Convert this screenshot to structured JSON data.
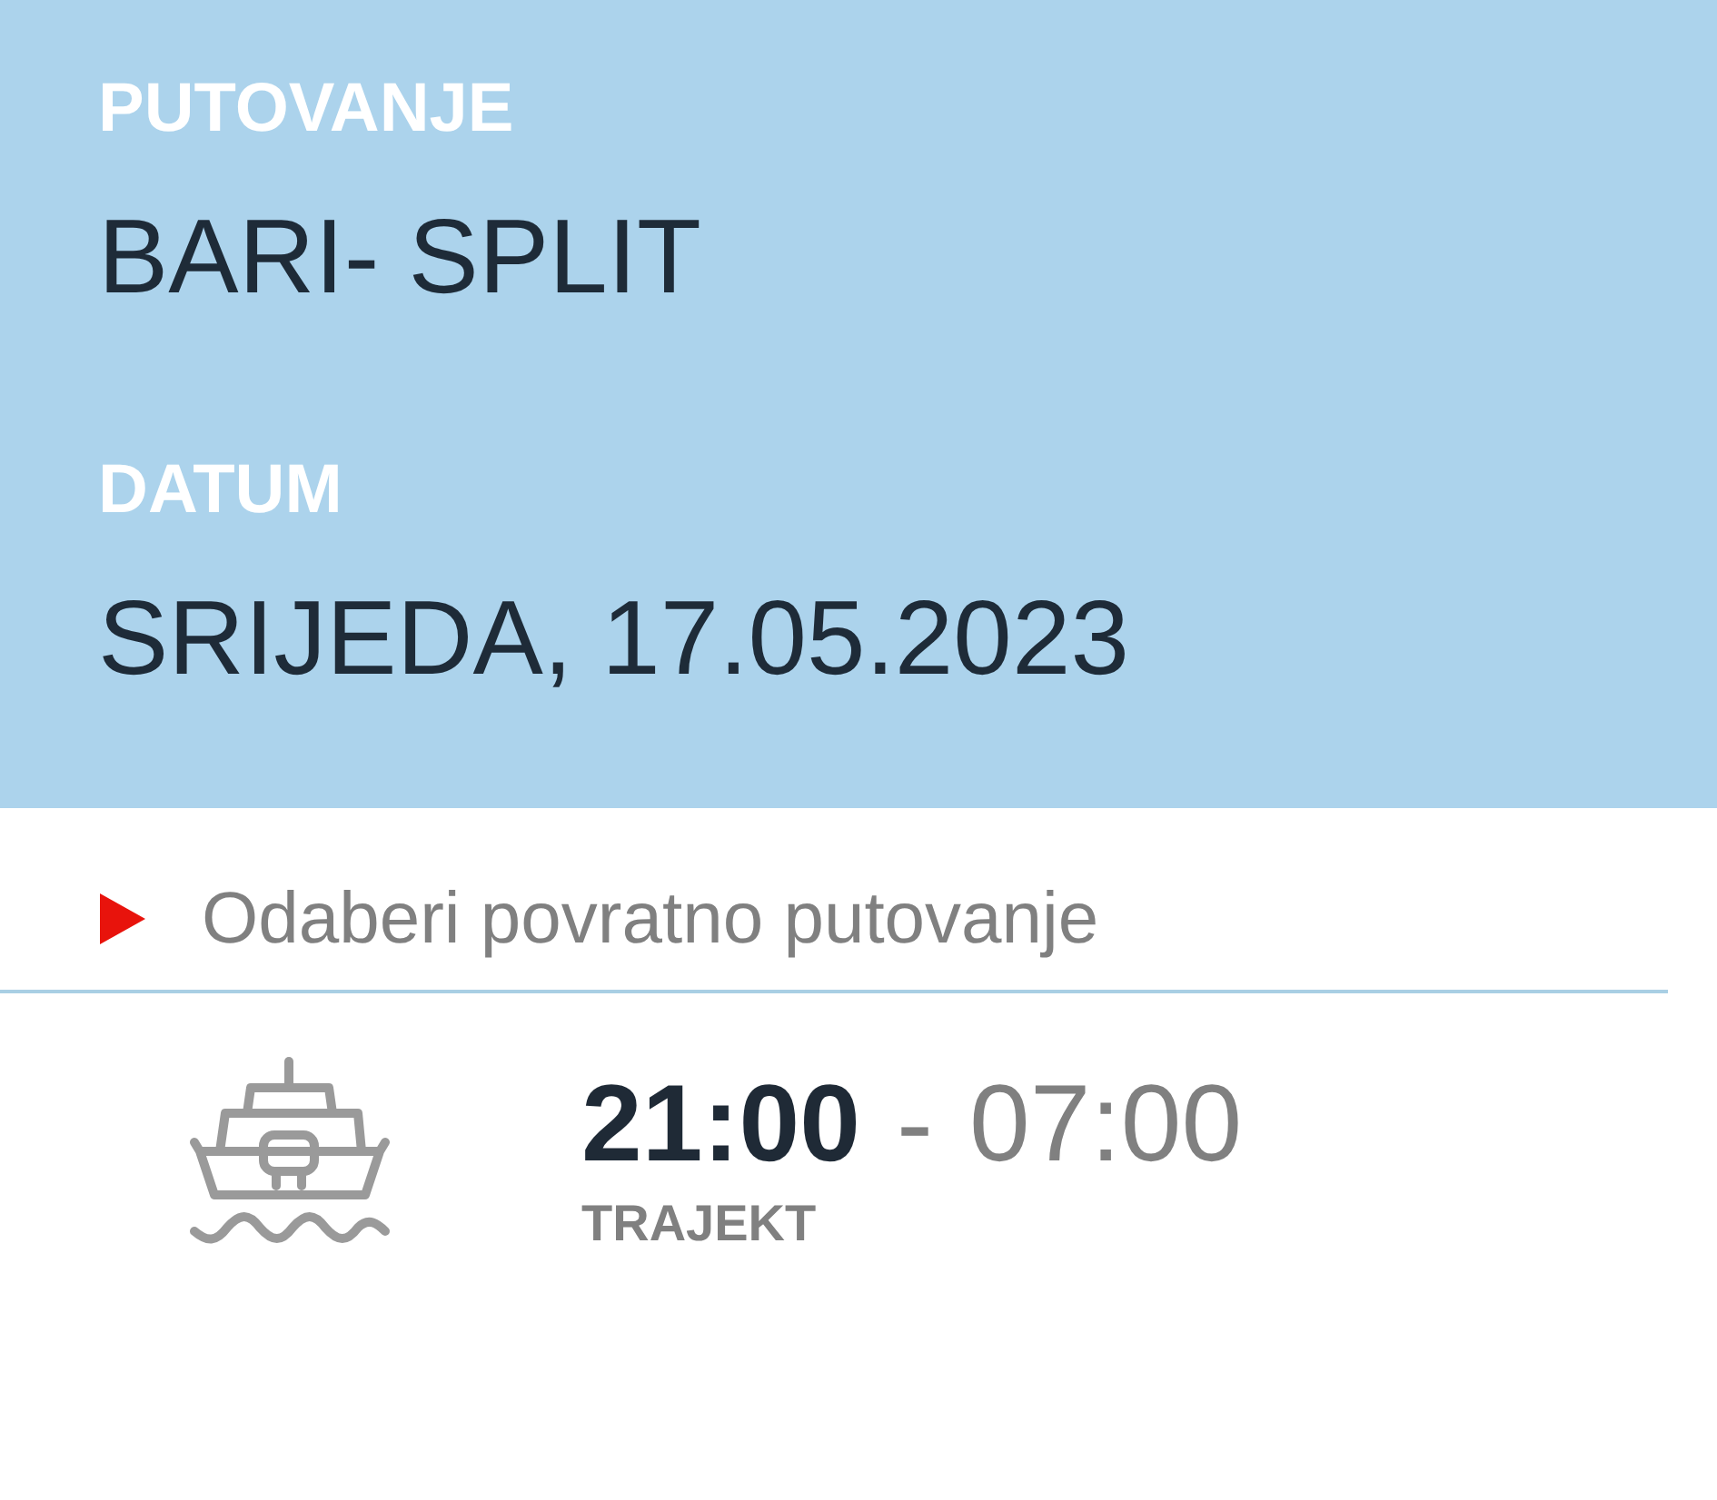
{
  "header": {
    "fields": [
      {
        "label": "PUTOVANJE",
        "value": "BARI- SPLIT"
      },
      {
        "label": "DATUM",
        "value": "SRIJEDA, 17.05.2023"
      }
    ]
  },
  "return_link": {
    "label": "Odaberi povratno putovanje"
  },
  "departures": [
    {
      "kind": "ferry",
      "departure": "21:00",
      "separator": "-",
      "arrival": "07:00",
      "type": "TRAJEKT"
    }
  ]
}
